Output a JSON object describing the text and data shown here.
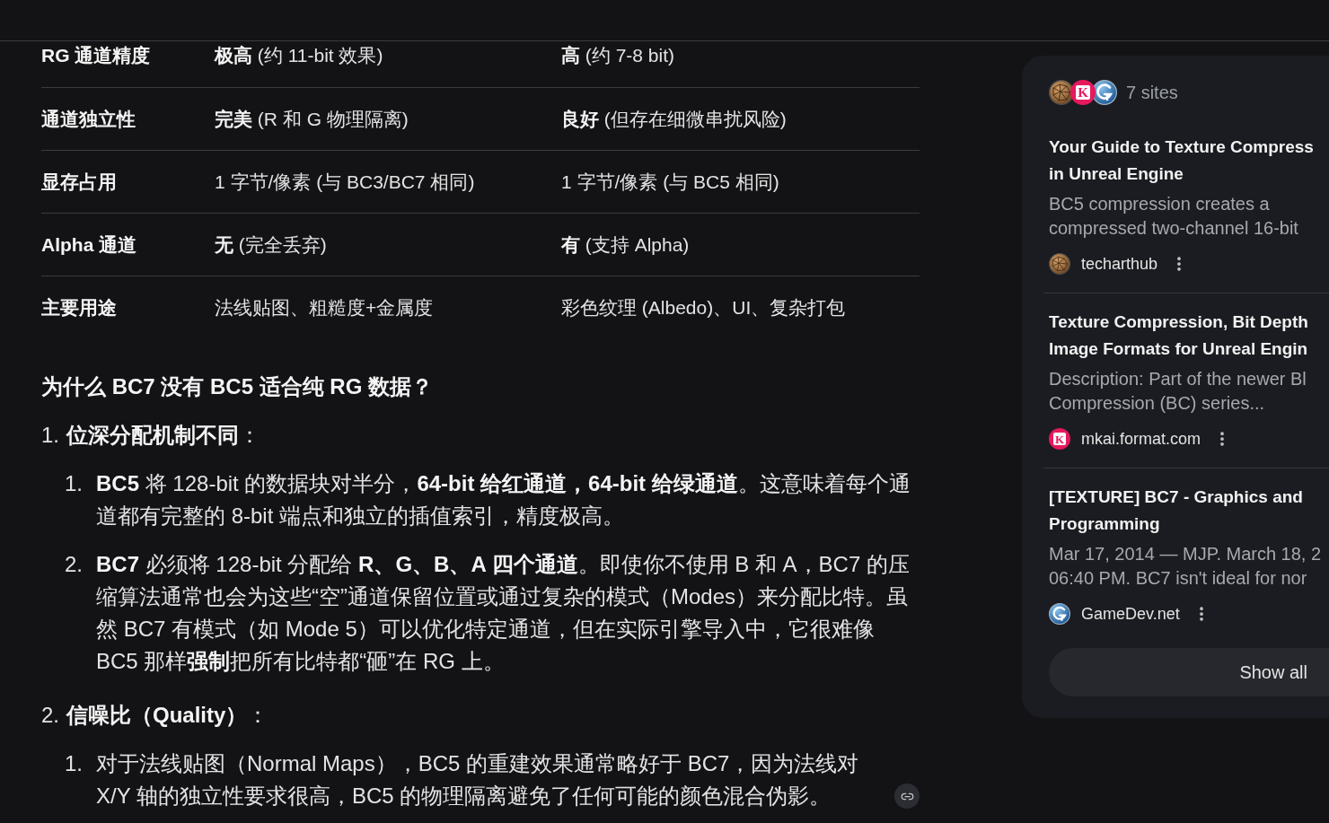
{
  "comparison_table": {
    "rows": [
      {
        "label": "RG 通道精度",
        "cells": [
          "**极高** (约 11-bit 效果)",
          "**高** (约 7-8 bit)"
        ]
      },
      {
        "label": "通道独立性",
        "cells": [
          "**完美** (R 和 G 物理隔离)",
          "**良好** (但存在细微串扰风险)"
        ]
      },
      {
        "label": "显存占用",
        "cells": [
          "1 字节/像素 (与 BC3/BC7 相同)",
          "1 字节/像素 (与 BC5 相同)"
        ]
      },
      {
        "label": "Alpha 通道",
        "cells": [
          "**无** (完全丢弃)",
          "**有** (支持 Alpha)"
        ]
      },
      {
        "label": "主要用途",
        "cells": [
          "法线贴图、粗糙度+金属度",
          "彩色纹理 (Albedo)、UI、复杂打包"
        ]
      }
    ]
  },
  "section": {
    "heading": "为什么 BC7 没有 BC5 适合纯 RG 数据？",
    "points": [
      {
        "number": "1.",
        "title": "**位深分配机制不同**：",
        "items": [
          {
            "number": "1.",
            "text": "**BC5** 将 128-bit 的数据块对半分，**64-bit 给红通道，64-bit 给绿通道**。这意味着每个通道都有完整的 8-bit 端点和独立的插值索引，精度极高。",
            "link_chip": false
          },
          {
            "number": "2.",
            "text": "**BC7** 必须将 128-bit 分配给 **R、G、B、A 四个通道**。即使你不使用 B 和 A，BC7 的压缩算法通常也会为这些“空”通道保留位置或通过复杂的模式（Modes）来分配比特。虽然 BC7 有模式（如 Mode 5）可以优化特定通道，但在实际引擎导入中，它很难像 BC5 那样**强制**把所有比特都“砸”在 RG 上。",
            "link_chip": false
          }
        ]
      },
      {
        "number": "2.",
        "title": "**信噪比（Quality）**：",
        "items": [
          {
            "number": "1.",
            "text": "对于法线贴图（Normal Maps），BC5 的重建效果通常略好于 BC7，因为法线对 X/Y 轴的独立性要求很高，BC5 的物理隔离避免了任何可能的颜色混合伪影。",
            "link_chip": true
          }
        ]
      }
    ]
  },
  "sources_panel": {
    "site_icons": [
      {
        "kind": "sphere"
      },
      {
        "kind": "letter",
        "text": "K"
      },
      {
        "kind": "swirl"
      }
    ],
    "count_label": "7 sites",
    "sources": [
      {
        "title_lines": [
          "Your Guide to Texture Compress",
          "in Unreal Engine"
        ],
        "snippet_lines": [
          "BC5 compression creates a",
          "compressed two-channel 16-bit"
        ],
        "logo": {
          "kind": "sphere"
        },
        "site": "techarthub"
      },
      {
        "title_lines": [
          "Texture Compression, Bit Depth",
          "Image Formats for Unreal Engin"
        ],
        "snippet_lines": [
          "Description: Part of the newer Bl",
          "Compression (BC) series..."
        ],
        "logo": {
          "kind": "letter",
          "text": "K"
        },
        "site": "mkai.format.com"
      },
      {
        "title_lines": [
          "[TEXTURE] BC7 - Graphics and",
          "Programming"
        ],
        "snippet_lines": [
          "Mar 17, 2014 — MJP. March 18, 2",
          "06:40 PM. BC7 isn't ideal for nor"
        ],
        "logo": {
          "kind": "swirl"
        },
        "site": "GameDev.net"
      }
    ],
    "show_all": "Show all"
  }
}
